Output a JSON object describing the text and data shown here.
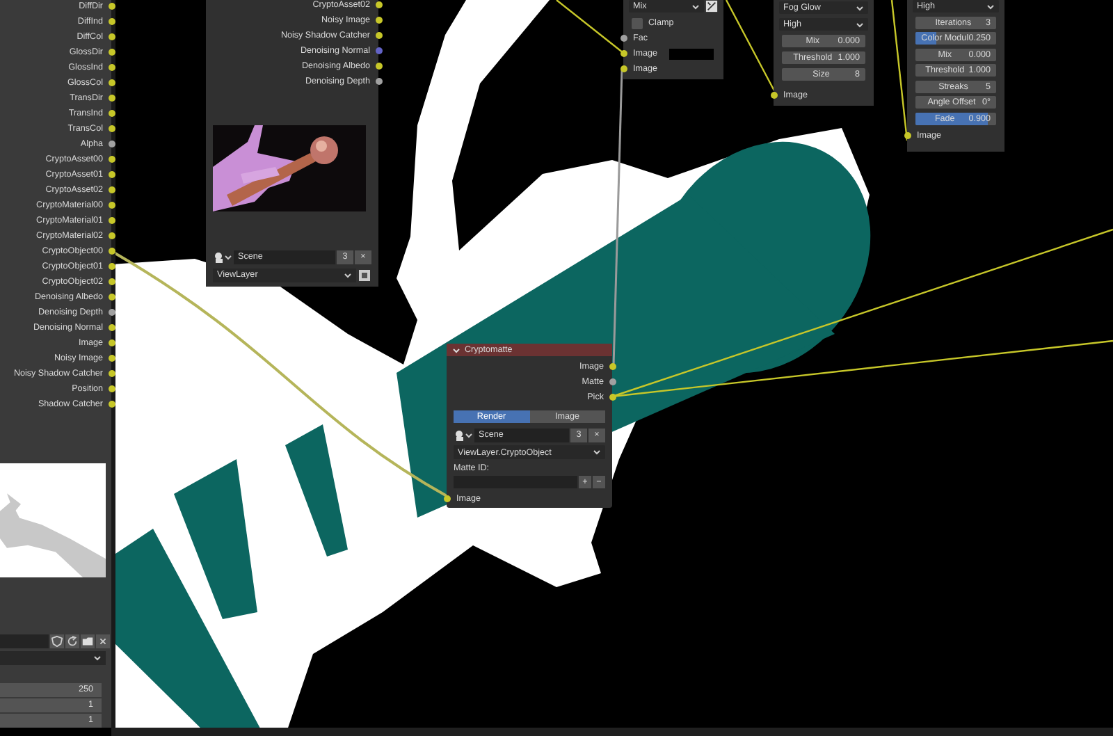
{
  "render_layers": {
    "outputs": [
      {
        "label": "DiffDir",
        "color": "#c7c729"
      },
      {
        "label": "DiffInd",
        "color": "#c7c729"
      },
      {
        "label": "DiffCol",
        "color": "#c7c729"
      },
      {
        "label": "GlossDir",
        "color": "#c7c729"
      },
      {
        "label": "GlossInd",
        "color": "#c7c729"
      },
      {
        "label": "GlossCol",
        "color": "#c7c729"
      },
      {
        "label": "TransDir",
        "color": "#c7c729"
      },
      {
        "label": "TransInd",
        "color": "#c7c729"
      },
      {
        "label": "TransCol",
        "color": "#c7c729"
      },
      {
        "label": "Alpha",
        "color": "#a1a1a1"
      },
      {
        "label": "CryptoAsset00",
        "color": "#c7c729"
      },
      {
        "label": "CryptoAsset01",
        "color": "#c7c729"
      },
      {
        "label": "CryptoAsset02",
        "color": "#c7c729"
      },
      {
        "label": "CryptoMaterial00",
        "color": "#c7c729"
      },
      {
        "label": "CryptoMaterial01",
        "color": "#c7c729"
      },
      {
        "label": "CryptoMaterial02",
        "color": "#c7c729"
      },
      {
        "label": "CryptoObject00",
        "color": "#c7c729"
      },
      {
        "label": "CryptoObject01",
        "color": "#c7c729"
      },
      {
        "label": "CryptoObject02",
        "color": "#c7c729"
      },
      {
        "label": "Denoising Albedo",
        "color": "#c7c729"
      },
      {
        "label": "Denoising Depth",
        "color": "#a1a1a1"
      },
      {
        "label": "Denoising Normal",
        "color": "#c7c729"
      },
      {
        "label": "Image",
        "color": "#c7c729"
      },
      {
        "label": "Noisy Image",
        "color": "#c7c729"
      },
      {
        "label": "Noisy Shadow Catcher",
        "color": "#c7c729"
      },
      {
        "label": "Position",
        "color": "#c7c729"
      },
      {
        "label": "Shadow Catcher",
        "color": "#c7c729"
      }
    ],
    "number_fields": [
      "250",
      "1",
      "1"
    ]
  },
  "render_layers_2": {
    "outputs": [
      {
        "label": "CryptoAsset02",
        "color": "#c7c729"
      },
      {
        "label": "Noisy Image",
        "color": "#c7c729"
      },
      {
        "label": "Noisy Shadow Catcher",
        "color": "#c7c729"
      },
      {
        "label": "Denoising Normal",
        "color": "#6363c7"
      },
      {
        "label": "Denoising Albedo",
        "color": "#c7c729"
      },
      {
        "label": "Denoising Depth",
        "color": "#a1a1a1"
      }
    ],
    "scene": {
      "value": "Scene",
      "users": "3",
      "close": "×"
    },
    "view_layer": "ViewLayer"
  },
  "mix_node": {
    "blend": "Mix",
    "clamp": {
      "label": "Clamp",
      "checked": false
    },
    "inputs": [
      {
        "label": "Fac",
        "color": "#a1a1a1",
        "kind": "socket"
      },
      {
        "label": "Image",
        "color": "#c7c729",
        "kind": "color_input"
      },
      {
        "label": "Image",
        "color": "#c7c729",
        "kind": "socket"
      }
    ]
  },
  "glare_node": {
    "type": "Fog Glow",
    "quality": "High",
    "fields": [
      {
        "label": "Mix",
        "value": "0.000"
      },
      {
        "label": "Threshold",
        "value": "1.000"
      },
      {
        "label": "Size",
        "value": "8"
      }
    ],
    "input": {
      "label": "Image",
      "color": "#c7c729"
    }
  },
  "glare_node_2": {
    "quality": "High",
    "fields": [
      {
        "label": "Iterations",
        "value": "3",
        "kind": "number"
      },
      {
        "label": "Color Modul",
        "value": "0.250",
        "kind": "slider",
        "level": 0.25
      },
      {
        "label": "Mix",
        "value": "0.000",
        "kind": "number"
      },
      {
        "label": "Threshold",
        "value": "1.000",
        "kind": "number"
      },
      {
        "label": "Streaks",
        "value": "5",
        "kind": "number"
      },
      {
        "label": "Angle Offset",
        "value": "0°",
        "kind": "number"
      },
      {
        "label": "Fade",
        "value": "0.900",
        "kind": "slider",
        "level": 0.9
      }
    ],
    "input": {
      "label": "Image",
      "color": "#c7c729"
    }
  },
  "cryptomatte": {
    "title": "Cryptomatte",
    "outputs": [
      {
        "label": "Image",
        "color": "#c7c729"
      },
      {
        "label": "Matte",
        "color": "#a1a1a1"
      },
      {
        "label": "Pick",
        "color": "#c7c729"
      }
    ],
    "tabs": [
      {
        "label": "Render",
        "selected": true
      },
      {
        "label": "Image",
        "selected": false
      }
    ],
    "scene": {
      "value": "Scene",
      "users": "3",
      "close": "×"
    },
    "layer": "ViewLayer.CryptoObject",
    "matte_id_label": "Matte ID:",
    "add": "+",
    "remove": "−",
    "input": {
      "label": "Image",
      "color": "#c7c729"
    }
  }
}
